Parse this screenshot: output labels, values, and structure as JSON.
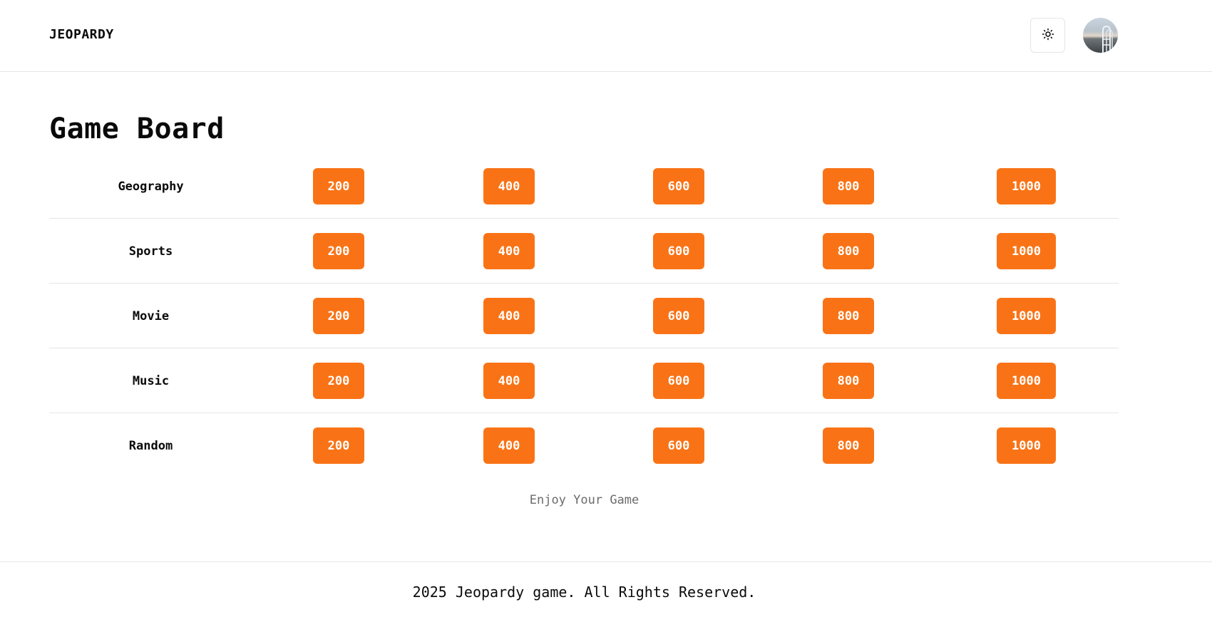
{
  "header": {
    "brand": "JEOPARDY",
    "theme_toggle_icon": "sun-icon",
    "avatar_icon": "avatar"
  },
  "main": {
    "title": "Game Board",
    "categories": [
      {
        "name": "Geography",
        "values": [
          "200",
          "400",
          "600",
          "800",
          "1000"
        ]
      },
      {
        "name": "Sports",
        "values": [
          "200",
          "400",
          "600",
          "800",
          "1000"
        ]
      },
      {
        "name": "Movie",
        "values": [
          "200",
          "400",
          "600",
          "800",
          "1000"
        ]
      },
      {
        "name": "Music",
        "values": [
          "200",
          "400",
          "600",
          "800",
          "1000"
        ]
      },
      {
        "name": "Random",
        "values": [
          "200",
          "400",
          "600",
          "800",
          "1000"
        ]
      }
    ],
    "tagline": "Enjoy Your Game"
  },
  "footer": {
    "copyright": "2025 Jeopardy game. All Rights Reserved."
  },
  "colors": {
    "accent": "#f97316",
    "border": "#e5e5e5",
    "muted_text": "#6b6b6b"
  }
}
